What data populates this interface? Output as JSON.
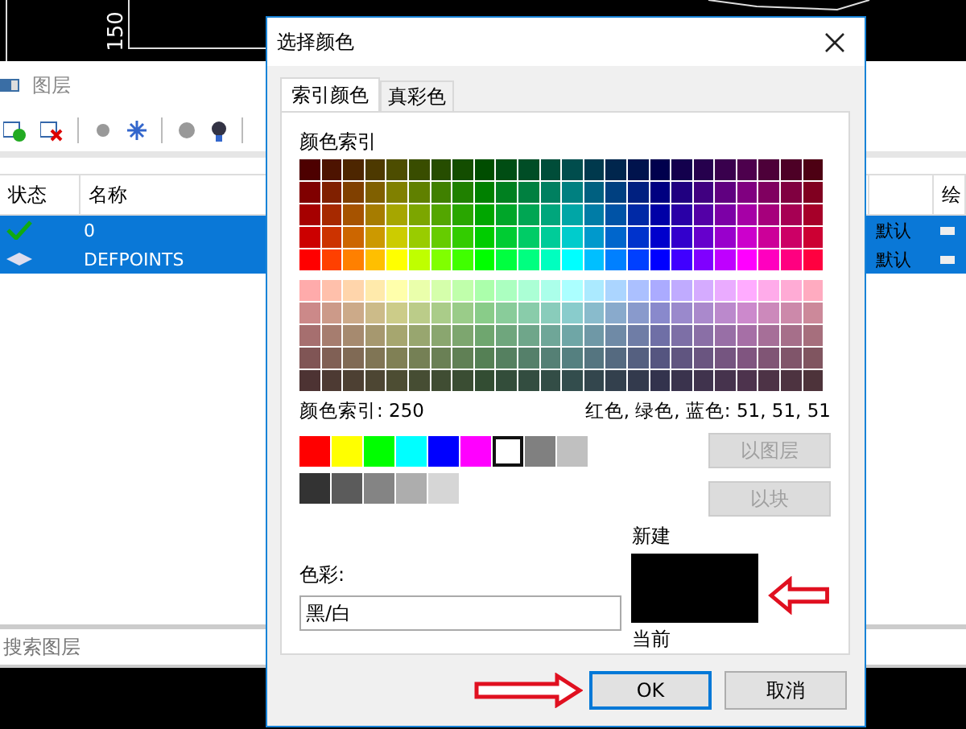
{
  "background": {
    "drawing_text": "150",
    "layers_panel": {
      "title": "图层",
      "columns": [
        "状态",
        "名称",
        "绘"
      ],
      "rows": [
        {
          "kind": "current",
          "name": "0",
          "column_3": "默认",
          "selected": true
        },
        {
          "kind": "layer",
          "name": "DEFPOINTS",
          "column_3": "默认",
          "selected": true
        }
      ],
      "search": {
        "placeholder": "搜索图层"
      }
    }
  },
  "dialog": {
    "title": "选择颜色",
    "tabs": [
      {
        "label": "索引颜色",
        "selected": true
      },
      {
        "label": "真彩色",
        "selected": false
      }
    ],
    "palette_label": "颜色索引",
    "index_reading": "颜色索引: 250",
    "rgb_reading": "红色, 绿色, 蓝色: 51, 51, 51",
    "standard_colors": [
      {
        "color": "#ff0000",
        "selected": false
      },
      {
        "color": "#ffff00",
        "selected": false
      },
      {
        "color": "#00ff00",
        "selected": false
      },
      {
        "color": "#00ffff",
        "selected": false
      },
      {
        "color": "#0000ff",
        "selected": false
      },
      {
        "color": "#ff00ff",
        "selected": false
      },
      {
        "color": "#ffffff",
        "selected": true
      },
      {
        "color": "#808080",
        "selected": false
      },
      {
        "color": "#c0c0c0",
        "selected": false
      }
    ],
    "gray_colors": [
      {
        "color": "#333333",
        "selected": false
      },
      {
        "color": "#5b5b5b",
        "selected": false
      },
      {
        "color": "#848484",
        "selected": false
      },
      {
        "color": "#adadad",
        "selected": false
      },
      {
        "color": "#d6d6d6",
        "selected": false
      }
    ],
    "side_buttons": [
      {
        "label": "以图层",
        "disabled": true
      },
      {
        "label": "以块",
        "disabled": true
      }
    ],
    "color_field": {
      "label": "色彩:",
      "value": "黑/白"
    },
    "preview": {
      "new_label": "新建",
      "current_label": "当前"
    },
    "buttons": [
      {
        "label": "OK",
        "default": true
      },
      {
        "label": "取消",
        "default": false
      }
    ]
  }
}
